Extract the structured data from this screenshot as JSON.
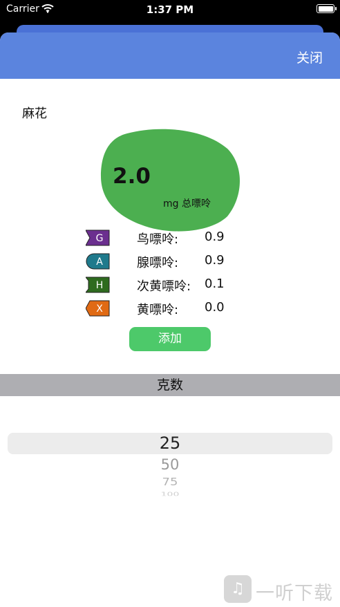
{
  "status_bar": {
    "carrier": "Carrier",
    "time": "1:37 PM"
  },
  "nav": {
    "close_label": "关闭"
  },
  "food": {
    "name": "麻花",
    "total_value": "2.0",
    "total_unit": "mg 总嘌呤"
  },
  "purines": [
    {
      "tag": "G",
      "label": "鸟嘌呤:",
      "value": "0.9",
      "color": "#6b2f8f",
      "shape": "flag"
    },
    {
      "tag": "A",
      "label": "腺嘌呤:",
      "value": "0.9",
      "color": "#1f7a8c",
      "shape": "round"
    },
    {
      "tag": "H",
      "label": "次黄嘌呤:",
      "value": "0.1",
      "color": "#2e6b1f",
      "shape": "notch"
    },
    {
      "tag": "X",
      "label": "黄嘌呤:",
      "value": "0.0",
      "color": "#e06a14",
      "shape": "arrow"
    }
  ],
  "add_button": "添加",
  "grams_header": "克数",
  "picker": {
    "options": [
      "25",
      "50",
      "75",
      "100"
    ],
    "selected": "25"
  },
  "watermark": {
    "text": "一听下载"
  },
  "colors": {
    "nav_background": "#5b84de",
    "blob": "#4caf50",
    "add_button": "#4dc96a",
    "grams_bar": "#aeaeb2"
  }
}
